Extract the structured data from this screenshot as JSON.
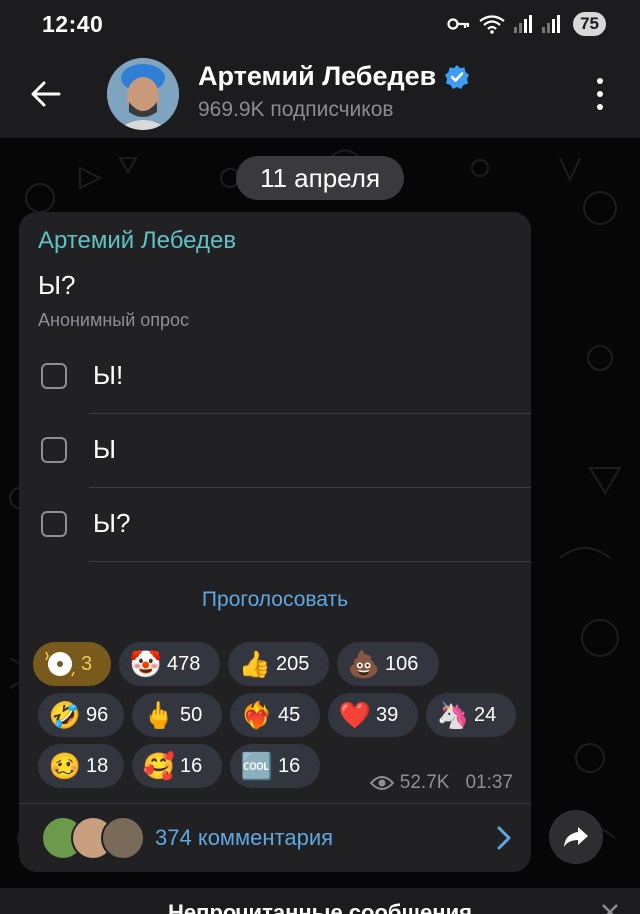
{
  "status_bar": {
    "time": "12:40",
    "battery": "75",
    "icons": [
      "key-icon",
      "wifi-icon",
      "signal-icon",
      "signal-roaming-icon"
    ]
  },
  "header": {
    "title": "Артемий Лебедев",
    "subtitle": "969.9K подписчиков",
    "verified": true
  },
  "date_pill": "11 апреля",
  "message": {
    "author": "Артемий Лебедев",
    "question": "Ы?",
    "poll_type": "Анонимный опрос",
    "options": [
      {
        "label": "Ы!"
      },
      {
        "label": "Ы"
      },
      {
        "label": "Ы?"
      }
    ],
    "vote_label": "Проголосовать",
    "reactions": [
      {
        "emoji": "⭐",
        "name": "paid-star-reaction",
        "count": "3",
        "selected": true
      },
      {
        "emoji": "🤡",
        "name": "clown-reaction",
        "count": "478"
      },
      {
        "emoji": "👍",
        "name": "thumbs-up-reaction",
        "count": "205"
      },
      {
        "emoji": "💩",
        "name": "poop-reaction",
        "count": "106"
      },
      {
        "emoji": "🤣",
        "name": "rofl-reaction",
        "count": "96"
      },
      {
        "emoji": "🖕",
        "name": "middle-finger-reaction",
        "count": "50"
      },
      {
        "emoji": "❤️‍🔥",
        "name": "heart-on-fire-reaction",
        "count": "45"
      },
      {
        "emoji": "❤️",
        "name": "heart-reaction",
        "count": "39"
      },
      {
        "emoji": "🦄",
        "name": "unicorn-reaction",
        "count": "24"
      },
      {
        "emoji": "🥴",
        "name": "woozy-reaction",
        "count": "18"
      },
      {
        "emoji": "🥰",
        "name": "smiling-hearts-reaction",
        "count": "16"
      },
      {
        "emoji": "🆒",
        "name": "cool-reaction",
        "count": "16"
      }
    ],
    "views": "52.7K",
    "time": "01:37",
    "comments_label": "374 комментария"
  },
  "unread_label": "Непрочитанные сообщения",
  "colors": {
    "accent_teal": "#5fc1c4",
    "link_blue": "#5fa8e0",
    "bubble_bg": "#212124",
    "reaction_bg": "#33353f",
    "paid_reaction_bg": "#7a5a1c"
  }
}
